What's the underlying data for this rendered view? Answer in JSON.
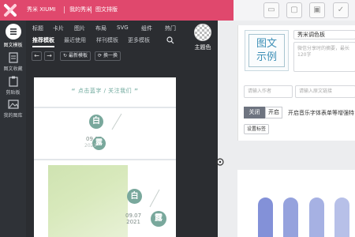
{
  "topbar": {
    "brand": "秀米 XIUMI",
    "my_xiumi": "我的秀米",
    "graphic_layout": "图文排版"
  },
  "leftnav": {
    "items": [
      {
        "label": "图文模板",
        "icon": "list-icon"
      },
      {
        "label": "图文收藏",
        "icon": "bookmark-icon"
      },
      {
        "label": "剪贴板",
        "icon": "clipboard-icon"
      },
      {
        "label": "我的图库",
        "icon": "image-icon"
      }
    ]
  },
  "panel": {
    "tabs1": [
      "标题",
      "卡片",
      "图片",
      "布局",
      "SVG",
      "组件",
      "热门"
    ],
    "tabs2": [
      "推荐模板",
      "最近使用",
      "样刊模板",
      "更多模板"
    ],
    "theme_label": "主题色",
    "toolbar": {
      "prev": "←",
      "next": "→",
      "new_template": "最新模板",
      "shuffle": "换一换"
    }
  },
  "templates": {
    "banner": "点击蓝字 / 关注我们",
    "card1": {
      "big": "白",
      "small": "露",
      "date": "09.07",
      "year": "2021"
    },
    "card2": {
      "big": "白",
      "small": "露",
      "date": "09.07",
      "year": "2021"
    }
  },
  "article": {
    "thumb_text": "图文示例",
    "title_value": "秀米调色板",
    "description_placeholder": "微信分享时的摘要，最长120字",
    "author_placeholder": "请输入作者",
    "source_placeholder": "请输入原文链接",
    "seg_close": "关闭",
    "seg_open": "开启",
    "music_hint": "开启音乐字体表单等增强特",
    "set_tags": "设置标签"
  },
  "palette": {
    "colors": [
      "#8391d8",
      "#95a2dd",
      "#a6b1e3",
      "#b7c0e8",
      "#c8cfee"
    ]
  }
}
